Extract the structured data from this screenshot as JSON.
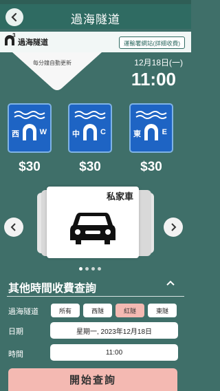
{
  "header": {
    "title": "過海隧道"
  },
  "info_strip": {
    "logo_text": "過海隧道",
    "logo_superscript": "3",
    "td_link_label": "運輸署網站(詳細收費)"
  },
  "notice": {
    "partial_text": "每分鐘自動更新"
  },
  "clock": {
    "date": "12月18日(一)",
    "time": "11:00"
  },
  "tunnels": [
    {
      "name": "西",
      "code": "W",
      "price": "$30"
    },
    {
      "name": "中",
      "code": "C",
      "price": "$30"
    },
    {
      "name": "東",
      "code": "E",
      "price": "$30"
    }
  ],
  "vehicle": {
    "label": "私家車",
    "icon": "car-icon"
  },
  "carousel": {
    "page_count": 4,
    "active_index": 0
  },
  "query": {
    "title": "其他時間收費查詢",
    "tunnel_label": "過海隧道",
    "tunnel_options": [
      "所有",
      "西隧",
      "紅隧",
      "東隧"
    ],
    "tunnel_selected": "紅隧",
    "date_label": "日期",
    "date_value": "星期一, 2023年12月18日",
    "time_label": "時間",
    "time_value": "11:00",
    "submit_label": "開始查詢"
  },
  "colors": {
    "header": "#2f6b62",
    "background": "#3f6f69",
    "accent_pink": "#f4b9b2",
    "tunnel_blue": "#1e64c4"
  }
}
